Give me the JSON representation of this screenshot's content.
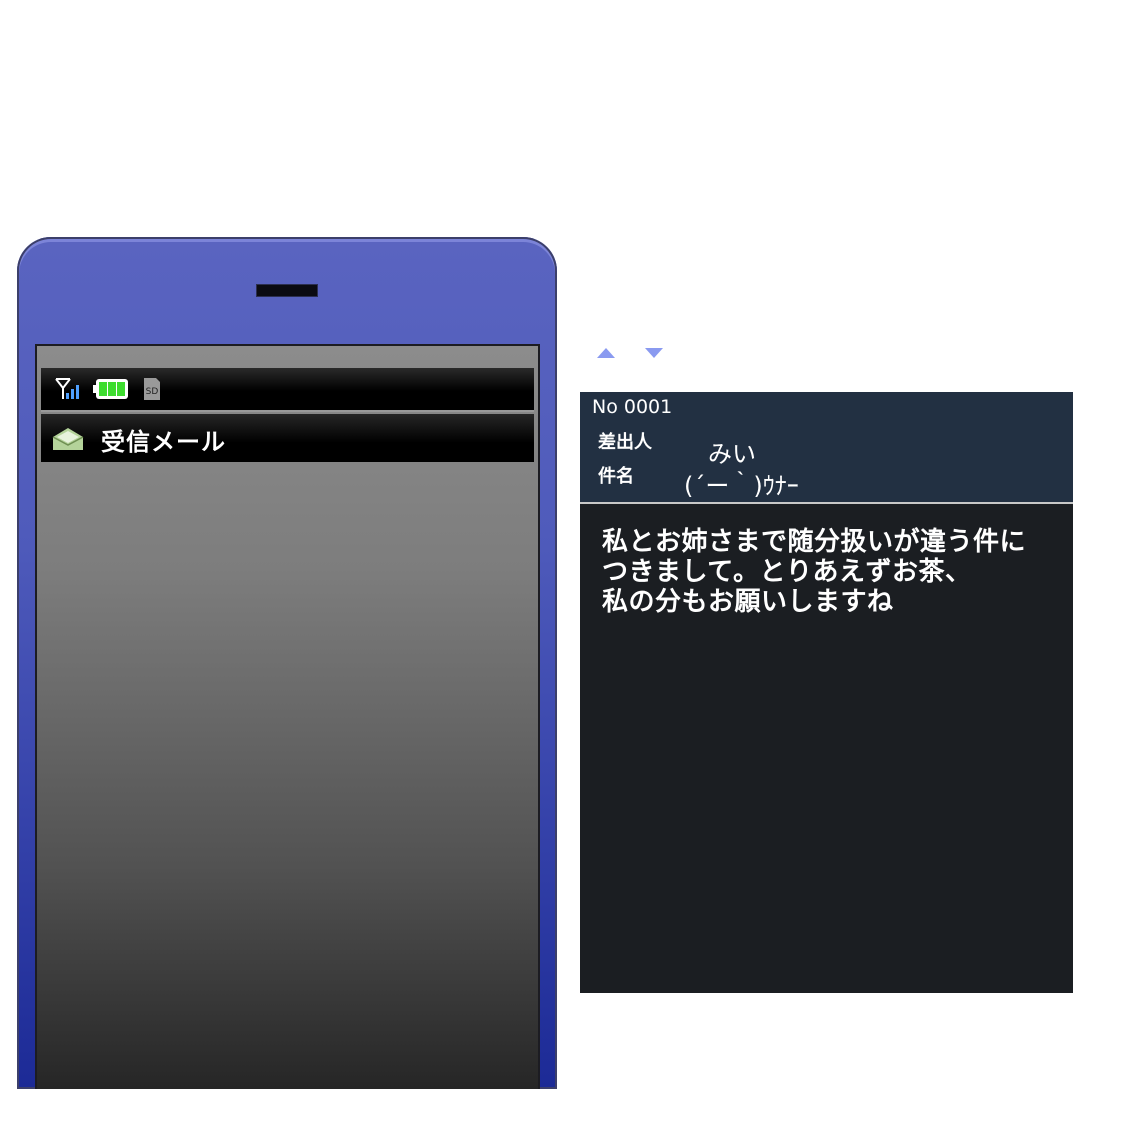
{
  "phone": {
    "status_icons": [
      "signal-antenna-icon",
      "battery-full-icon",
      "sd-card-icon"
    ],
    "sd_label": "SD",
    "header": {
      "icon": "opened-mail-icon",
      "title": "受信メール"
    }
  },
  "nav": {
    "up_icon": "scroll-up-arrow-icon",
    "down_icon": "scroll-down-arrow-icon"
  },
  "mail": {
    "number": "No 0001",
    "from_label": "差出人",
    "from_value": "みい",
    "subject_label": "件名",
    "subject_value": "(´ー｀)ｳﾅｰ",
    "body": "私とお姉さまで随分扱いが違う件に\nつきまして。とりあえずお茶、\n私の分もお願いしますね"
  },
  "colors": {
    "phone_body": "#4f5bbb",
    "phone_body_bottom": "#1c2a96",
    "mail_header_bg": "#223042",
    "mail_body_bg": "#1b1e22",
    "arrow": "#8a9af0",
    "battery": "#3ddc2e"
  }
}
